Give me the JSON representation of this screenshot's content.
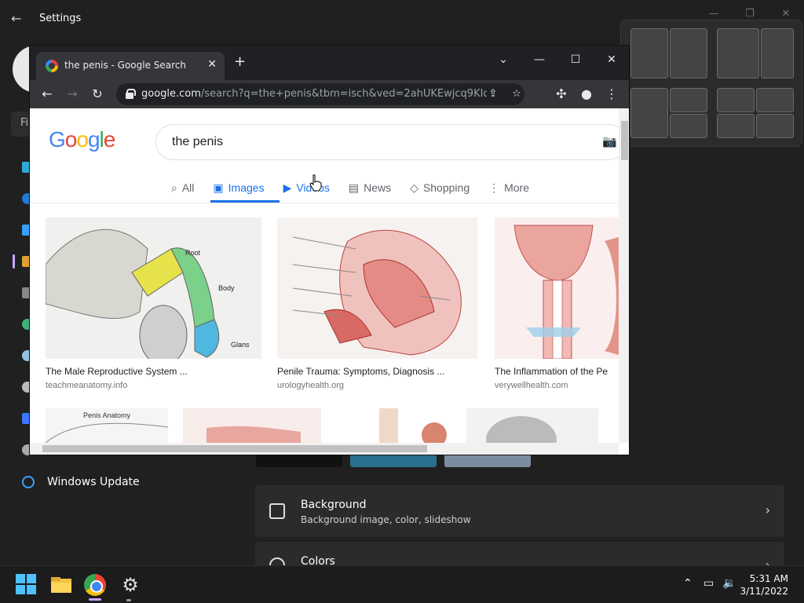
{
  "settings": {
    "title": "Settings",
    "find_placeholder": "Fi",
    "windows_update_label": "Windows Update",
    "background_card": {
      "title": "Background",
      "subtitle": "Background image, color, slideshow"
    },
    "colors_card": {
      "title": "Colors"
    }
  },
  "chrome": {
    "tab_title": "the penis - Google Search",
    "url_host": "google.com",
    "url_rest": "/search?q=the+penis&tbm=isch&ved=2ahUKEwjcq9KIqr3..."
  },
  "google": {
    "logo": "Google",
    "query": "the penis",
    "tabs": [
      {
        "label": "All",
        "icon": "search-icon"
      },
      {
        "label": "Images",
        "icon": "image-icon"
      },
      {
        "label": "Videos",
        "icon": "video-icon"
      },
      {
        "label": "News",
        "icon": "news-icon"
      },
      {
        "label": "Shopping",
        "icon": "tag-icon"
      },
      {
        "label": "More",
        "icon": "kebab-icon"
      }
    ],
    "results": [
      {
        "title": "The Male Reproductive System ...",
        "source": "teachmeanatomy.info",
        "labels": [
          "Root",
          "Body",
          "Glans"
        ]
      },
      {
        "title": "Penile Trauma: Symptoms, Diagnosis ...",
        "source": "urologyhealth.org"
      },
      {
        "title": "The Inflammation of the Pe",
        "source": "verywellhealth.com"
      }
    ],
    "row2_first_label": "Penis Anatomy"
  },
  "taskbar": {
    "time": "5:31 AM",
    "date": "3/11/2022"
  },
  "colors": {
    "google_blue": "#4285f4",
    "google_red": "#ea4335",
    "google_yellow": "#fbbc05",
    "google_green": "#34a853",
    "active_tab": "#1a73e8"
  }
}
